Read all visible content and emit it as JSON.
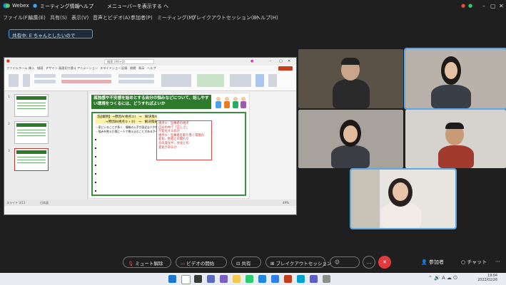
{
  "titlebar": {
    "app_name": "Webex",
    "meeting_title": "ミーティング情報",
    "help": "ヘルプ",
    "notice": "メニューバーを表示する へ",
    "minimize": "–",
    "restore": "▢",
    "close": "✕"
  },
  "menubar": {
    "items": [
      "ファイル(F)",
      "編集(E)",
      "共有(S)",
      "表示(V)",
      "音声とビデオ(A)",
      "参加者(P)",
      "ミーティング(M)",
      "ブレイクアウトセッション(B)",
      "ヘルプ(H)"
    ]
  },
  "share_badge": "共有中: E ちゃんとしたいので",
  "ppt": {
    "search_placeholder": "検索 (Alt+Q)",
    "tabs": [
      "ファイル",
      "ホーム",
      "挿入",
      "描画",
      "デザイン",
      "画面切り替え",
      "アニメーション",
      "スライドショー",
      "記録",
      "校閲",
      "表示",
      "ヘルプ"
    ],
    "slide_title": "孤独感や不安感を始めとする自分の悩みなどについて、話しやすい環境をつくるには、どうすればよいか",
    "box_line1": "【記載例】→原因A(視点①)　→　解決策A",
    "box_line2": "　　　→原因B(視点①・②)　→　解決策B",
    "box_line3": "・家にいることが多く、情報の入手が身近な人や情報源が限られている。",
    "box_line4": "・悩みを抱えた際に一人で抱え込むことがあるが一方的に相談することのできる人が少ないため、",
    "note_lines": [
      "視点①：当事者の視点",
      "自分の中で「正しさ」",
      "が変化するのか",
      "視点②：当事者を取り巻く環境の",
      "変化、他者との関わり",
      "方の変化や、文化との",
      "変化があるか"
    ],
    "status_left": "スライド 3/13",
    "status_lang": "日本語",
    "status_zoom": "49%"
  },
  "toolbar": {
    "mute": "ミュート解除",
    "video": "ビデオの開始",
    "share": "共有",
    "breakout": "ブレイクアウトセッション",
    "participants": "参加者",
    "chat": "チャット",
    "more": "…"
  },
  "taskbar": {
    "time": "19:04",
    "date": "2022/02/26"
  },
  "colors": {
    "accent": "#5aa9e6",
    "slide_green": "#2d7a2d",
    "end_red": "#e23b3b",
    "note_red": "#d32f2f"
  }
}
